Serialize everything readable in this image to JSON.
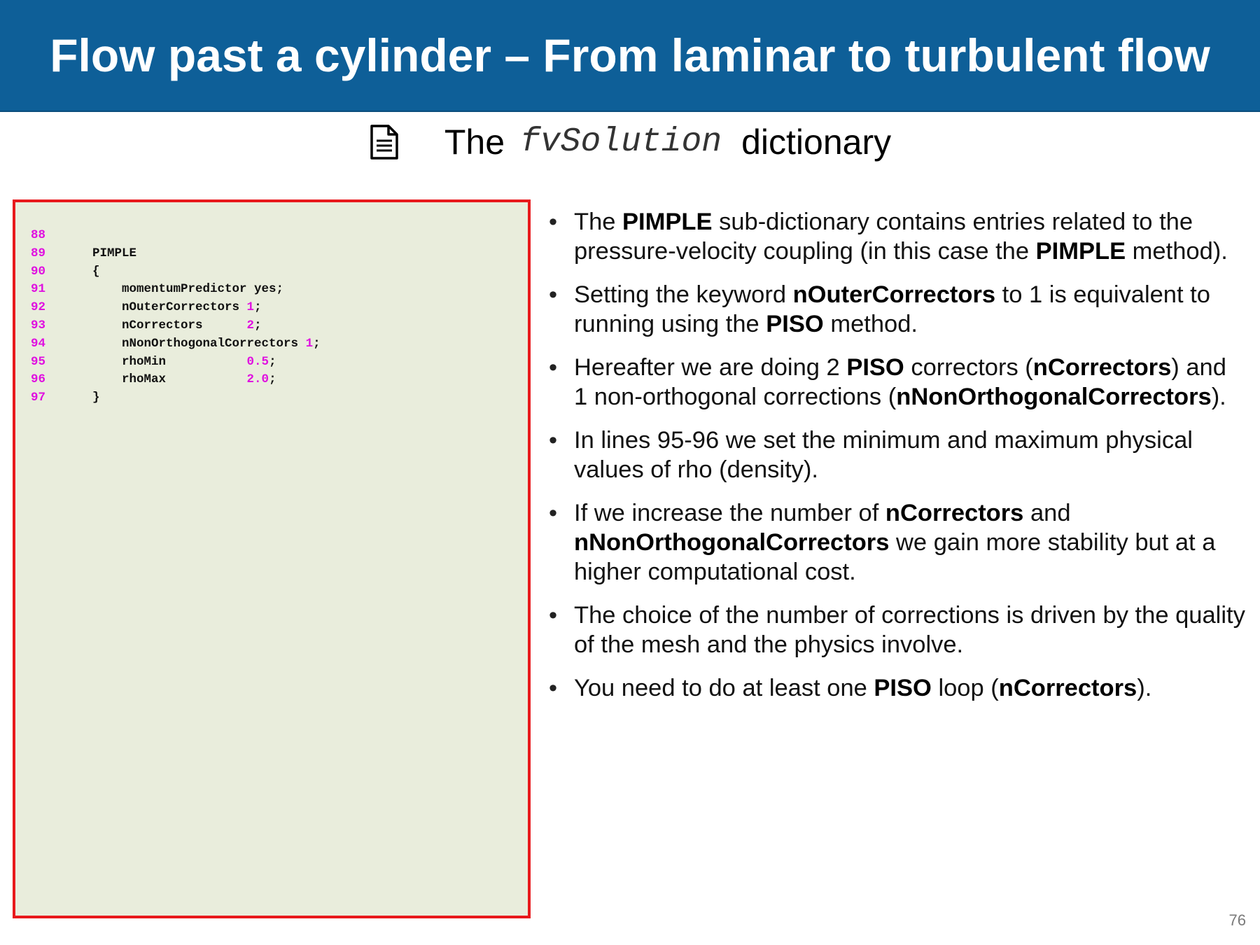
{
  "slide": {
    "title": "Flow past a cylinder – From laminar to turbulent flow",
    "subtitle_prefix": "The",
    "subtitle_code": "fvSolution",
    "subtitle_suffix": "dictionary",
    "page_number": "76"
  },
  "icons": {
    "subtitle_icon": "document-icon"
  },
  "colors": {
    "title_bar": "#0e5f98",
    "code_background": "#e9eddc",
    "code_border": "#e8191c",
    "line_number": "#e010e0",
    "numeric_literal": "#e010e0"
  },
  "code": {
    "lines": [
      {
        "number": "88",
        "text": "",
        "value": "",
        "end": ""
      },
      {
        "number": "89",
        "text": "PIMPLE",
        "value": "",
        "end": ""
      },
      {
        "number": "90",
        "text": "{",
        "value": "",
        "end": ""
      },
      {
        "number": "91",
        "text": "    momentumPredictor yes;",
        "value": "",
        "end": ""
      },
      {
        "number": "92",
        "text": "    nOuterCorrectors ",
        "value": "1",
        "end": ";"
      },
      {
        "number": "93",
        "text": "    nCorrectors      ",
        "value": "2",
        "end": ";"
      },
      {
        "number": "94",
        "text": "    nNonOrthogonalCorrectors ",
        "value": "1",
        "end": ";"
      },
      {
        "number": "95",
        "text": "    rhoMin           ",
        "value": "0.5",
        "end": ";"
      },
      {
        "number": "96",
        "text": "    rhoMax           ",
        "value": "2.0",
        "end": ";"
      },
      {
        "number": "97",
        "text": "}",
        "value": "",
        "end": ""
      }
    ]
  },
  "bullets": [
    {
      "segments": [
        {
          "t": "The ",
          "b": false
        },
        {
          "t": "PIMPLE",
          "b": true
        },
        {
          "t": " sub-dictionary contains entries related to the pressure-velocity coupling (in this case the ",
          "b": false
        },
        {
          "t": "PIMPLE",
          "b": true
        },
        {
          "t": " method).",
          "b": false
        }
      ]
    },
    {
      "segments": [
        {
          "t": "Setting the keyword ",
          "b": false
        },
        {
          "t": "nOuterCorrectors",
          "b": true
        },
        {
          "t": " to 1 is equivalent to running using the ",
          "b": false
        },
        {
          "t": "PISO",
          "b": true
        },
        {
          "t": " method.",
          "b": false
        }
      ]
    },
    {
      "segments": [
        {
          "t": "Hereafter we are doing 2 ",
          "b": false
        },
        {
          "t": "PISO",
          "b": true
        },
        {
          "t": " correctors (",
          "b": false
        },
        {
          "t": "nCorrectors",
          "b": true
        },
        {
          "t": ") and 1 non-orthogonal corrections (",
          "b": false
        },
        {
          "t": "nNonOrthogonalCorrectors",
          "b": true
        },
        {
          "t": ").",
          "b": false
        }
      ]
    },
    {
      "segments": [
        {
          "t": "In lines 95-96 we set the minimum and maximum physical values of rho (density).",
          "b": false
        }
      ]
    },
    {
      "segments": [
        {
          "t": "If we increase the number of ",
          "b": false
        },
        {
          "t": "nCorrectors",
          "b": true
        },
        {
          "t": " and ",
          "b": false
        },
        {
          "t": "nNonOrthogonalCorrectors",
          "b": true
        },
        {
          "t": " we gain more stability but at a higher computational cost.",
          "b": false
        }
      ]
    },
    {
      "segments": [
        {
          "t": "The choice of the number of corrections is driven by the quality of the mesh and the physics involve.",
          "b": false
        }
      ]
    },
    {
      "segments": [
        {
          "t": "You need to do at least one ",
          "b": false
        },
        {
          "t": "PISO",
          "b": true
        },
        {
          "t": " loop (",
          "b": false
        },
        {
          "t": "nCorrectors",
          "b": true
        },
        {
          "t": ").",
          "b": false
        }
      ]
    }
  ]
}
